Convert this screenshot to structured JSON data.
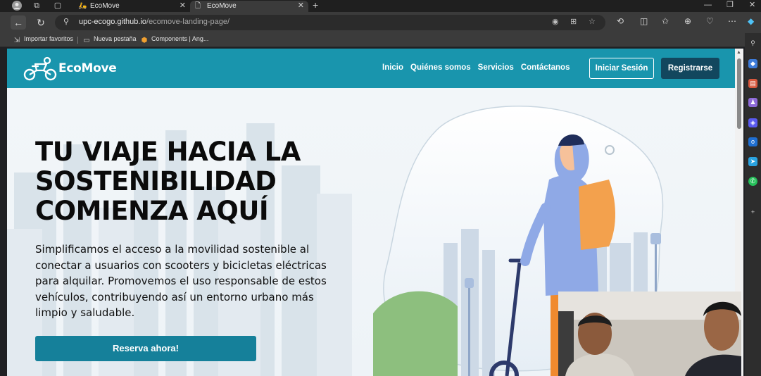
{
  "browser": {
    "tabs": [
      {
        "title": "EcoMove",
        "favicon": "scooter-icon",
        "active": false
      },
      {
        "title": "EcoMove",
        "favicon": "page-icon",
        "active": true
      }
    ],
    "url": {
      "host": "upc-ecogo.github.io",
      "path": "/ecomove-landing-page/"
    },
    "bookmarks": [
      {
        "label": "Importar favoritos",
        "icon": "import-icon"
      },
      {
        "label": "Nueva pestaña",
        "icon": "tab-icon"
      },
      {
        "label": "Components | Ang...",
        "icon": "angular-icon"
      }
    ]
  },
  "site": {
    "brand": "EcoMove",
    "nav": [
      "Inicio",
      "Quiénes somos",
      "Servicios",
      "Contáctanos"
    ],
    "login_label": "Iniciar Sesión",
    "register_label": "Registrarse",
    "colors": {
      "primary": "#1995ad",
      "dark": "#12475e",
      "button": "#15809a"
    }
  },
  "hero": {
    "title_lines": [
      "TU VIAJE HACIA LA",
      "SOSTENIBILIDAD",
      "COMIENZA AQUÍ"
    ],
    "description": "Simplificamos el acceso a la movilidad sostenible al conectar a usuarios con scooters y bicicletas eléctricas para alquilar. Promovemos el uso responsable de estos vehículos, contribuyendo así un entorno urbano más limpio y saludable.",
    "cta_label": "Reserva ahora!"
  }
}
